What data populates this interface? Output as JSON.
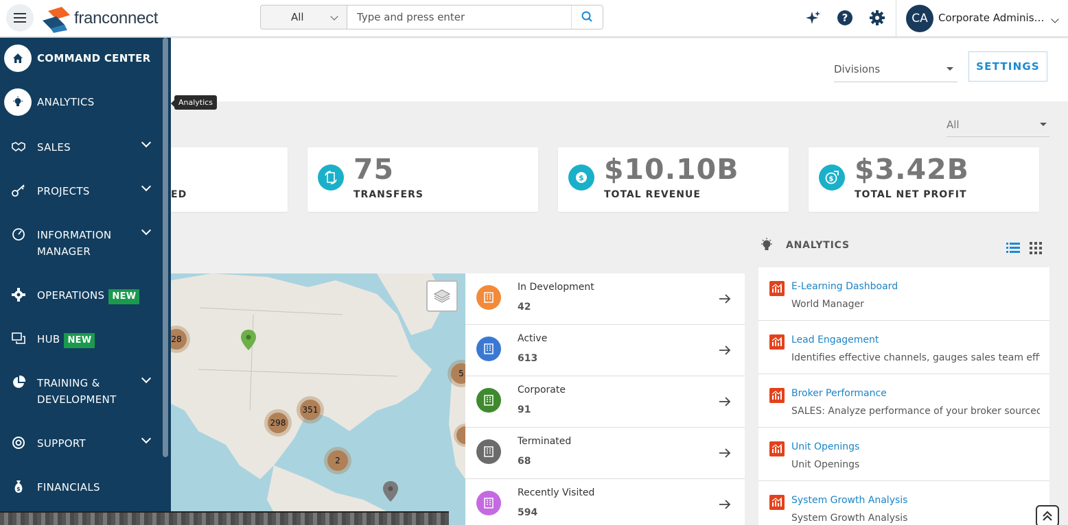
{
  "topbar": {
    "brand": "franconnect",
    "search_scope": "All",
    "search_placeholder": "Type and press enter",
    "user_initials": "CA",
    "user_name": "Corporate Administr..."
  },
  "sidebar": {
    "items": [
      {
        "label": "COMMAND CENTER",
        "icon": "home-icon"
      },
      {
        "label": "ANALYTICS",
        "icon": "lightbulb-icon"
      },
      {
        "label": "SALES",
        "icon": "handshake-icon"
      },
      {
        "label": "PROJECTS",
        "icon": "key-icon"
      },
      {
        "label": "INFORMATION",
        "label2": "MANAGER",
        "icon": "gauge-icon"
      },
      {
        "label": "OPERATIONS",
        "badge": "NEW",
        "icon": "gear-icon"
      },
      {
        "label": "HUB",
        "badge": "NEW",
        "icon": "chat-icon"
      },
      {
        "label": "TRAINING &",
        "label2": "DEVELOPMENT",
        "icon": "pie-icon"
      },
      {
        "label": "SUPPORT",
        "icon": "lifebuoy-icon"
      },
      {
        "label": "FINANCIALS",
        "icon": "money-bag-icon"
      }
    ],
    "tooltip": "Analytics"
  },
  "header": {
    "divisions_label": "Divisions",
    "settings_label": "SETTINGS",
    "filter_value": "All"
  },
  "stats": [
    {
      "value": "",
      "label": "ED"
    },
    {
      "value": "75",
      "label": "TRANSFERS"
    },
    {
      "value": "$10.10B",
      "label": "TOTAL REVENUE"
    },
    {
      "value": "$3.42B",
      "label": "TOTAL NET PROFIT"
    }
  ],
  "map": {
    "clusters": [
      "28",
      "351",
      "298",
      "2",
      "5"
    ]
  },
  "status_list": [
    {
      "label": "In Development",
      "count": "42",
      "color": "#f28a3a"
    },
    {
      "label": "Active",
      "count": "613",
      "color": "#3a78d4"
    },
    {
      "label": "Corporate",
      "count": "91",
      "color": "#3f8a2e"
    },
    {
      "label": "Terminated",
      "count": "68",
      "color": "#6b6b6b"
    },
    {
      "label": "Recently Visited",
      "count": "594",
      "color": "#c46ae0"
    }
  ],
  "analytics": {
    "title": "ANALYTICS",
    "items": [
      {
        "title": "E-Learning Dashboard",
        "desc": "World Manager"
      },
      {
        "title": "Lead Engagement",
        "desc": "Identifies effective channels, gauges sales team efficiency"
      },
      {
        "title": "Broker Performance",
        "desc": "SALES: Analyze performance of your broker sourced leads"
      },
      {
        "title": "Unit Openings",
        "desc": "Unit Openings"
      },
      {
        "title": "System Growth Analysis",
        "desc": "System Growth Analysis"
      }
    ]
  }
}
